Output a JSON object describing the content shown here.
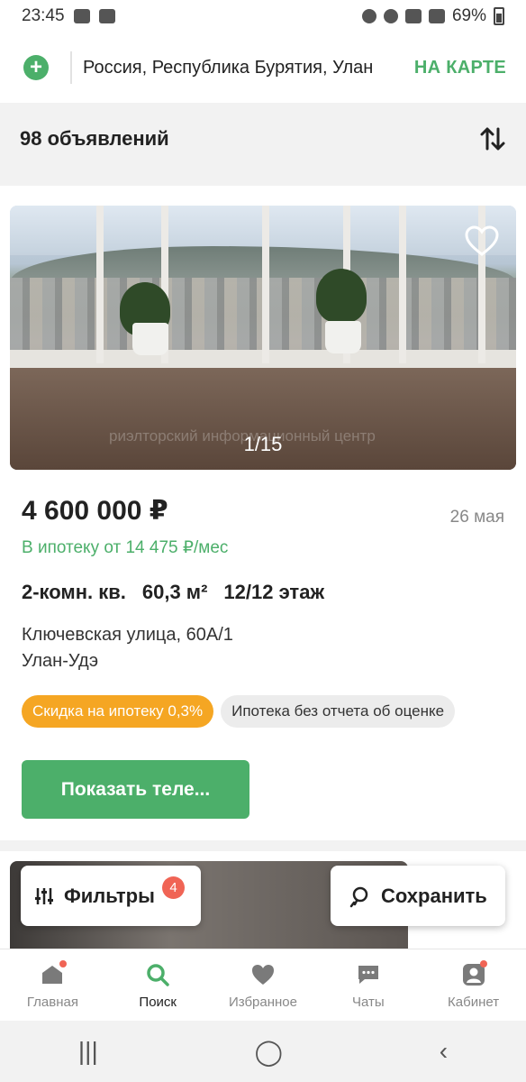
{
  "status_bar": {
    "time": "23:45",
    "battery": "69%"
  },
  "search": {
    "location": "Россия, Республика Бурятия, Улан",
    "map_label": "НА КАРТЕ"
  },
  "results": {
    "count_label": "98 объявлений"
  },
  "listing": {
    "photo_counter": "1/15",
    "watermark": "риэлторский информационный центр",
    "price": "4 600 000 ₽",
    "date": "26 мая",
    "mortgage": "В ипотеку от 14 475 ₽/мес",
    "rooms": "2-комн. кв.",
    "area": "60,3 м²",
    "floor": "12/12 этаж",
    "street": "Ключевская улица, 60А/1",
    "city": "Улан-Удэ",
    "tags": [
      "Скидка на ипотеку 0,3%",
      "Ипотека без отчета об оценке"
    ],
    "show_phone_label": "Показать теле..."
  },
  "floating": {
    "filters_label": "Фильтры",
    "filters_count": "4",
    "save_label": "Сохранить"
  },
  "nav": {
    "items": [
      {
        "label": "Главная",
        "icon": "home-icon"
      },
      {
        "label": "Поиск",
        "icon": "search-icon"
      },
      {
        "label": "Избранное",
        "icon": "heart-icon"
      },
      {
        "label": "Чаты",
        "icon": "chat-icon"
      },
      {
        "label": "Кабинет",
        "icon": "profile-icon"
      }
    ]
  },
  "colors": {
    "accent": "#4caf6a",
    "tag_orange": "#f5a623",
    "badge": "#f06455"
  }
}
